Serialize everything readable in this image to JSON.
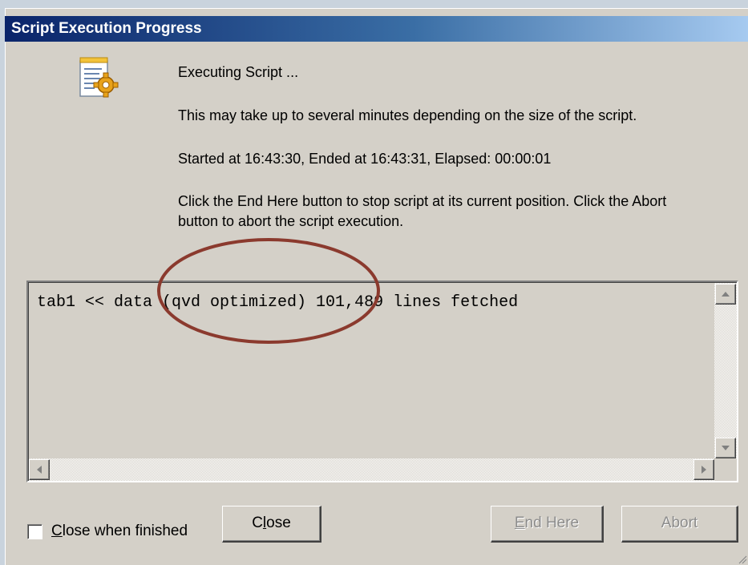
{
  "window": {
    "title": "Script Execution Progress"
  },
  "messages": {
    "status": "Executing Script ...",
    "info": "This may take up to several minutes depending on the size of the script.",
    "timing": "Started at 16:43:30, Ended at 16:43:31,  Elapsed: 00:00:01",
    "help_line1": "Click the End Here button to stop script at its current position. Click the Abort",
    "help_line2": "button to abort the script execution."
  },
  "log": {
    "line1": "tab1 << data (qvd optimized) 101,489 lines fetched"
  },
  "controls": {
    "close_when_finished": {
      "label": "Close when finished",
      "checked": false
    },
    "close_button": "Close",
    "end_here_button": "End Here",
    "abort_button": "Abort"
  },
  "icons": {
    "script": "script-gear-icon",
    "scroll_up": "arrow-up-icon",
    "scroll_down": "arrow-down-icon",
    "scroll_left": "arrow-left-icon",
    "scroll_right": "arrow-right-icon"
  },
  "colors": {
    "titlebar_start": "#0a246a",
    "titlebar_end": "#a6caf0",
    "dialog_face": "#d4d0c8",
    "annotation_ellipse": "#8b3a2e"
  }
}
